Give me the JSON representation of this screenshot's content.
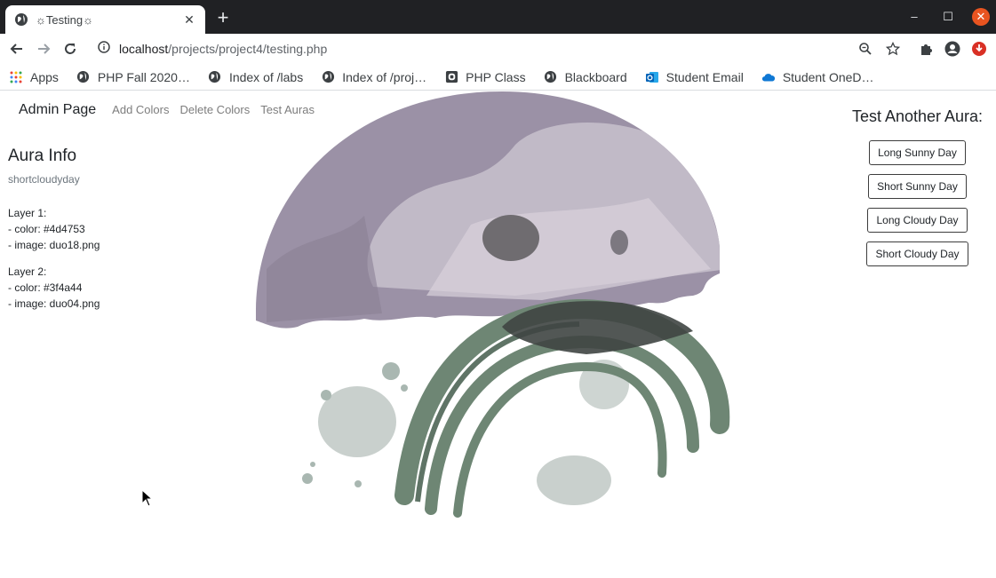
{
  "browser": {
    "tab_title": "☼Testing☼",
    "url_host": "localhost",
    "url_path": "/projects/project4/testing.php"
  },
  "bookmarks": [
    {
      "label": "Apps",
      "icon": "apps-grid-icon"
    },
    {
      "label": "PHP Fall 2020…",
      "icon": "globe-icon"
    },
    {
      "label": "Index of /labs",
      "icon": "globe-icon"
    },
    {
      "label": "Index of /proj…",
      "icon": "globe-icon"
    },
    {
      "label": "PHP Class",
      "icon": "document-icon"
    },
    {
      "label": "Blackboard",
      "icon": "globe-icon"
    },
    {
      "label": "Student Email",
      "icon": "outlook-icon"
    },
    {
      "label": "Student OneD…",
      "icon": "onedrive-icon"
    }
  ],
  "nav": {
    "brand": "Admin Page",
    "links": [
      "Add Colors",
      "Delete Colors",
      "Test Auras"
    ]
  },
  "info": {
    "title": "Aura Info",
    "name": "shortcloudyday",
    "layers": [
      {
        "heading": "Layer 1:",
        "color": "- color: #4d4753",
        "image": "- image: duo18.png"
      },
      {
        "heading": "Layer 2:",
        "color": "- color: #3f4a44",
        "image": "- image: duo04.png"
      }
    ]
  },
  "right": {
    "title": "Test Another Aura:",
    "buttons": [
      "Long Sunny Day",
      "Short Sunny Day",
      "Long Cloudy Day",
      "Short Cloudy Day"
    ]
  },
  "colors": {
    "cloud": "#938a9e",
    "arch": "#6e8674",
    "overlap": "#3f4542",
    "splash": "#c9d0cd"
  }
}
